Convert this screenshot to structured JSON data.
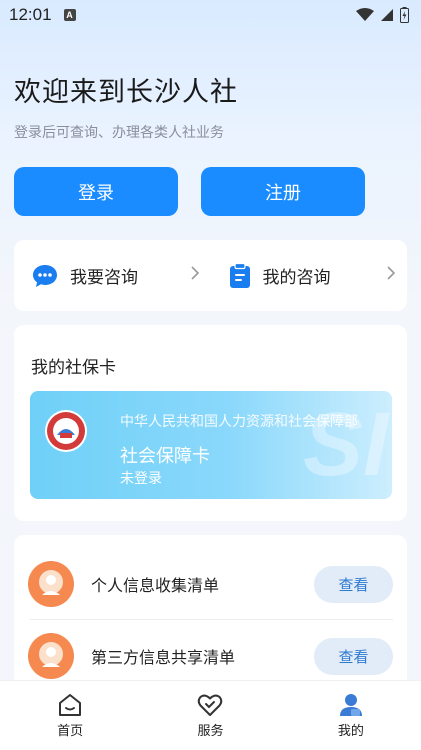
{
  "status_bar": {
    "time": "12:01",
    "badge": "A"
  },
  "welcome": {
    "title": "欢迎来到长沙人社",
    "subtitle": "登录后可查询、办理各类人社业务"
  },
  "auth": {
    "login_label": "登录",
    "register_label": "注册"
  },
  "consult": {
    "ask_label": "我要咨询",
    "mine_label": "我的咨询"
  },
  "social_card": {
    "section_title": "我的社保卡",
    "org": "中华人民共和国人力资源和社会保障部",
    "card_name": "社会保障卡",
    "status": "未登录",
    "watermark": "SI"
  },
  "lists": [
    {
      "label": "个人信息收集清单",
      "action": "查看"
    },
    {
      "label": "第三方信息共享清单",
      "action": "查看"
    }
  ],
  "nav": [
    {
      "label": "首页",
      "icon": "home-icon"
    },
    {
      "label": "服务",
      "icon": "heart-check-icon"
    },
    {
      "label": "我的",
      "icon": "user-icon",
      "active": true
    }
  ],
  "colors": {
    "primary": "#1a8cff",
    "accent_orange": "#f5894f",
    "active_nav": "#3a7bd5"
  }
}
